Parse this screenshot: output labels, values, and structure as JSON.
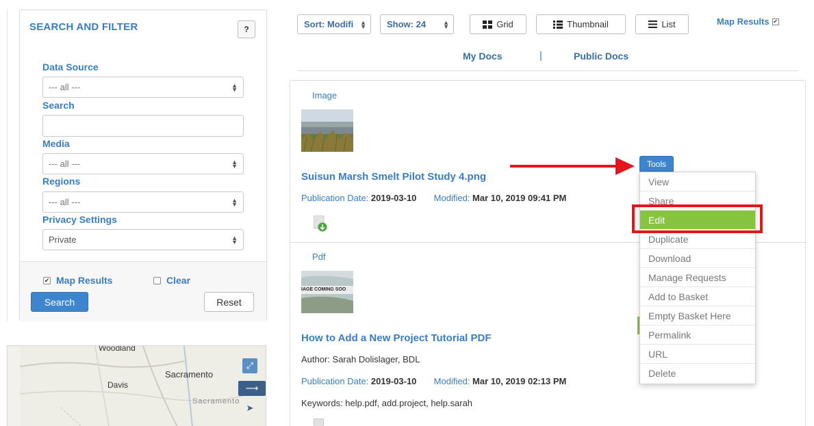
{
  "sidebar": {
    "title": "SEARCH AND FILTER",
    "help_label": "?",
    "data_source": {
      "label": "Data Source",
      "value": "--- all ---"
    },
    "search": {
      "label": "Search",
      "value": ""
    },
    "media": {
      "label": "Media",
      "value": "--- all ---"
    },
    "regions": {
      "label": "Regions",
      "value": "--- all ---"
    },
    "privacy": {
      "label": "Privacy Settings",
      "value": "Private"
    },
    "map_results": {
      "label": "Map Results",
      "checked": true
    },
    "clear": {
      "label": "Clear",
      "checked": false
    },
    "search_button": "Search",
    "reset_button": "Reset"
  },
  "map": {
    "places": [
      "Woodland",
      "Sacramento",
      "Davis",
      "Sacramento"
    ],
    "expand_icon": "expand-icon",
    "arrow_icon": "arrow-right-icon",
    "pointer_icon": "cursor-icon"
  },
  "toolbar": {
    "sort_label": "Sort: Modifi",
    "show_label": "Show: 24",
    "grid_label": "Grid",
    "thumbnail_label": "Thumbnail",
    "list_label": "List",
    "map_results_label": "Map Results",
    "map_results_checked": true
  },
  "tabs": {
    "my_docs": "My Docs",
    "separator": "|",
    "public_docs": "Public Docs"
  },
  "results": [
    {
      "type": "Image",
      "title": "Suisun Marsh Smelt Pilot Study 4.png",
      "publication_label": "Publication Date:",
      "publication_date": "2019-03-10",
      "modified_label": "Modified:",
      "modified_date": "Mar 10, 2019 09:41 PM"
    },
    {
      "type": "Pdf",
      "thumb_text": "IAGE COMING SOO",
      "title": "How to Add a New Project Tutorial PDF",
      "author": "Author: Sarah Dolislager, BDL",
      "publication_label": "Publication Date:",
      "publication_date": "2019-03-10",
      "modified_label": "Modified:",
      "modified_date": "Mar 10, 2019 02:13 PM",
      "keywords": "Keywords: help.pdf, add.project, help.sarah"
    }
  ],
  "tools": {
    "button": "Tools",
    "items": [
      "View",
      "Share",
      "Edit",
      "Duplicate",
      "Download",
      "Manage Requests",
      "Add to Basket",
      "Empty Basket Here",
      "Permalink",
      "URL",
      "Delete"
    ],
    "active_item": "Edit"
  },
  "colors": {
    "link_blue": "#3a7dbf",
    "primary_button": "#3d86cf",
    "menu_active": "#86c440",
    "annotation_red": "#e8141b"
  }
}
